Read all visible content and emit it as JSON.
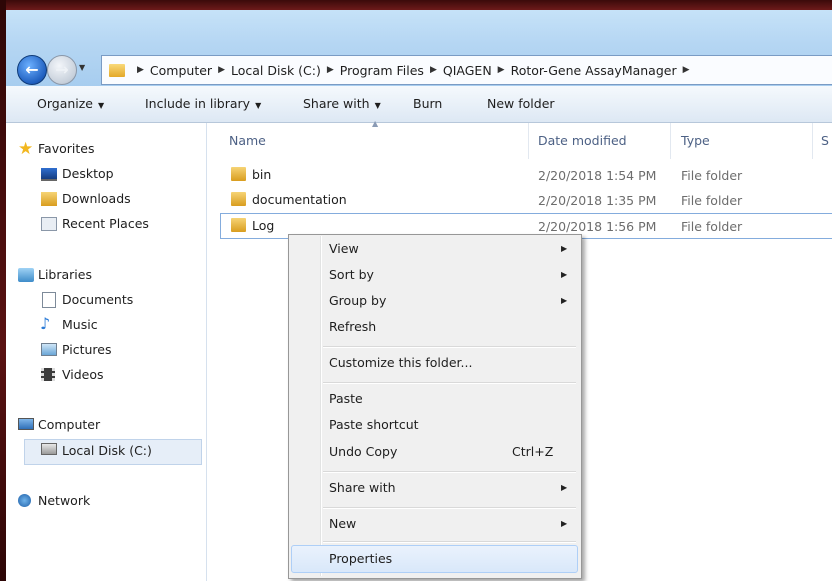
{
  "address": {
    "crumbs": [
      "Computer",
      "Local Disk (C:)",
      "Program Files",
      "QIAGEN",
      "Rotor-Gene AssayManager"
    ]
  },
  "toolbar": {
    "organize": "Organize",
    "include_in_library": "Include in library",
    "share_with": "Share with",
    "burn": "Burn",
    "new_folder": "New folder"
  },
  "nav": {
    "favorites": "Favorites",
    "desktop": "Desktop",
    "downloads": "Downloads",
    "recent_places": "Recent Places",
    "libraries": "Libraries",
    "documents": "Documents",
    "music": "Music",
    "pictures": "Pictures",
    "videos": "Videos",
    "computer": "Computer",
    "local_disk": "Local Disk (C:)",
    "network": "Network"
  },
  "columns": {
    "name": "Name",
    "date_modified": "Date modified",
    "type": "Type",
    "size": "S"
  },
  "files": [
    {
      "name": "bin",
      "date": "2/20/2018 1:54 PM",
      "type": "File folder"
    },
    {
      "name": "documentation",
      "date": "2/20/2018 1:35 PM",
      "type": "File folder"
    },
    {
      "name": "Log",
      "date": "2/20/2018 1:56 PM",
      "type": "File folder"
    }
  ],
  "context_menu": {
    "view": "View",
    "sort_by": "Sort by",
    "group_by": "Group by",
    "refresh": "Refresh",
    "customize": "Customize this folder...",
    "paste": "Paste",
    "paste_shortcut": "Paste shortcut",
    "undo_copy": "Undo Copy",
    "undo_shortcut": "Ctrl+Z",
    "share_with": "Share with",
    "new": "New",
    "properties": "Properties"
  },
  "colors": {
    "address_bar": "#b5d6f3",
    "selection_border": "#84acdd",
    "menu_highlight": "#d9e8fa"
  }
}
